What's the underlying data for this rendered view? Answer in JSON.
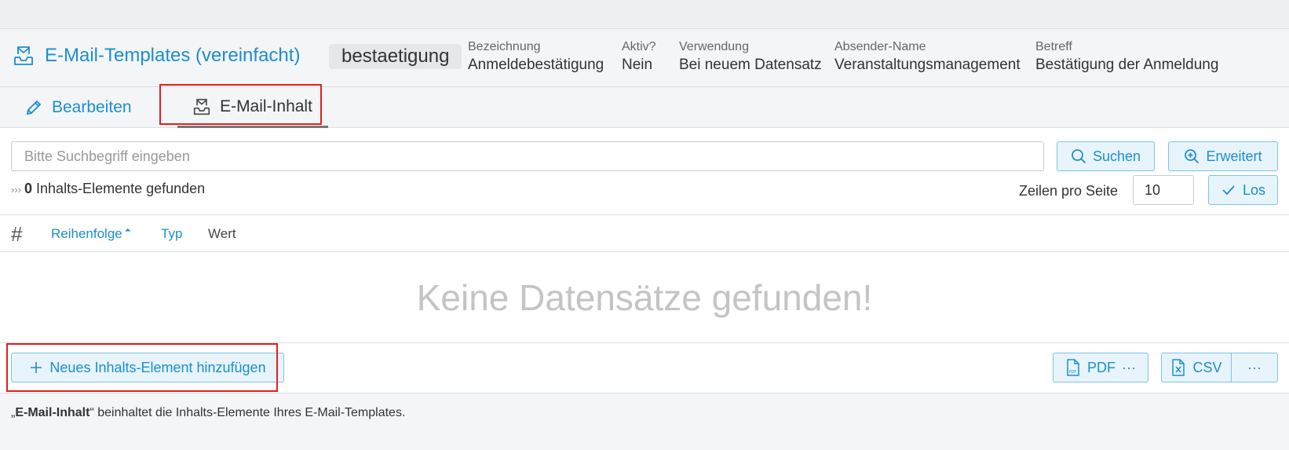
{
  "header": {
    "title": "E-Mail-Templates (vereinfacht)",
    "key": "bestaetigung",
    "meta": [
      {
        "label": "Bezeichnung",
        "value": "Anmeldebestätigung"
      },
      {
        "label": "Aktiv?",
        "value": "Nein"
      },
      {
        "label": "Verwendung",
        "value": "Bei neuem Datensatz"
      },
      {
        "label": "Absender-Name",
        "value": "Veranstaltungsmanagement"
      },
      {
        "label": "Betreff",
        "value": "Bestätigung der Anmeldung"
      }
    ]
  },
  "tabs": [
    {
      "label": "Bearbeiten",
      "icon": "pencil-icon"
    },
    {
      "label": "E-Mail-Inhalt",
      "icon": "mail-tray-icon",
      "active": true
    }
  ],
  "search": {
    "placeholder": "Bitte Suchbegriff eingeben",
    "value": "",
    "search_label": "Suchen",
    "extended_label": "Erweitert"
  },
  "results": {
    "prefix": "›››",
    "count": "0",
    "text": "Inhalts-Elemente gefunden",
    "rows_label": "Zeilen pro Seite",
    "rows_value": "10",
    "go_label": "Los"
  },
  "table": {
    "columns": [
      {
        "label": "#"
      },
      {
        "label": "Reihenfolge",
        "sortable": true,
        "sort": "asc"
      },
      {
        "label": "Typ",
        "sortable": true
      },
      {
        "label": "Wert",
        "sortable": false
      }
    ],
    "empty_text": "Keine Datensätze gefunden!"
  },
  "actions": {
    "add_label": "Neues Inhalts-Element hinzufügen",
    "pdf_label": "PDF",
    "csv_label": "CSV",
    "more_label": "···"
  },
  "note": {
    "open_quote": "„",
    "strong": "E-Mail-Inhalt",
    "rest": "“ beinhaltet die Inhalts-Elemente Ihres E-Mail-Templates."
  },
  "colors": {
    "accent": "#1a8fcf",
    "highlight": "#e02020"
  }
}
